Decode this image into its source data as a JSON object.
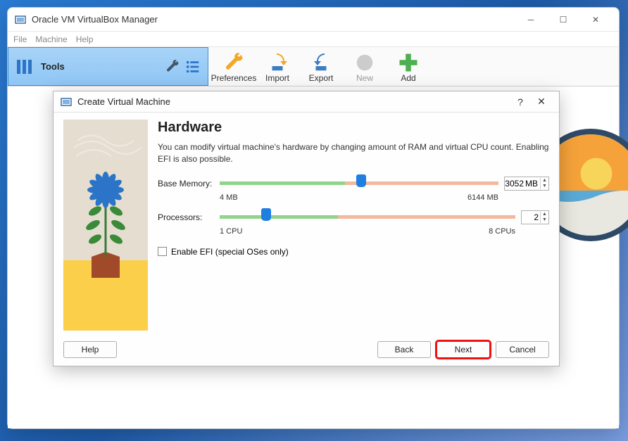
{
  "window": {
    "title": "Oracle VM VirtualBox Manager",
    "menu": [
      "File",
      "Machine",
      "Help"
    ]
  },
  "tools": {
    "label": "Tools"
  },
  "toolbar": {
    "preferences": "Preferences",
    "import": "Import",
    "export": "Export",
    "new": "New",
    "add": "Add"
  },
  "wizard": {
    "title": "Create Virtual Machine",
    "heading": "Hardware",
    "description": "You can modify virtual machine's hardware by changing amount of RAM and virtual CPU count. Enabling EFI is also possible.",
    "memory": {
      "label": "Base Memory:",
      "value": "3052",
      "unit": "MB",
      "min_label": "4 MB",
      "max_label": "6144 MB",
      "thumb_percent": 49
    },
    "cpu": {
      "label": "Processors:",
      "value": "2",
      "min_label": "1 CPU",
      "max_label": "8 CPUs",
      "thumb_percent": 14
    },
    "efi": {
      "label": "Enable EFI (special OSes only)",
      "checked": false
    },
    "buttons": {
      "help": "Help",
      "back": "Back",
      "next": "Next",
      "cancel": "Cancel"
    }
  }
}
